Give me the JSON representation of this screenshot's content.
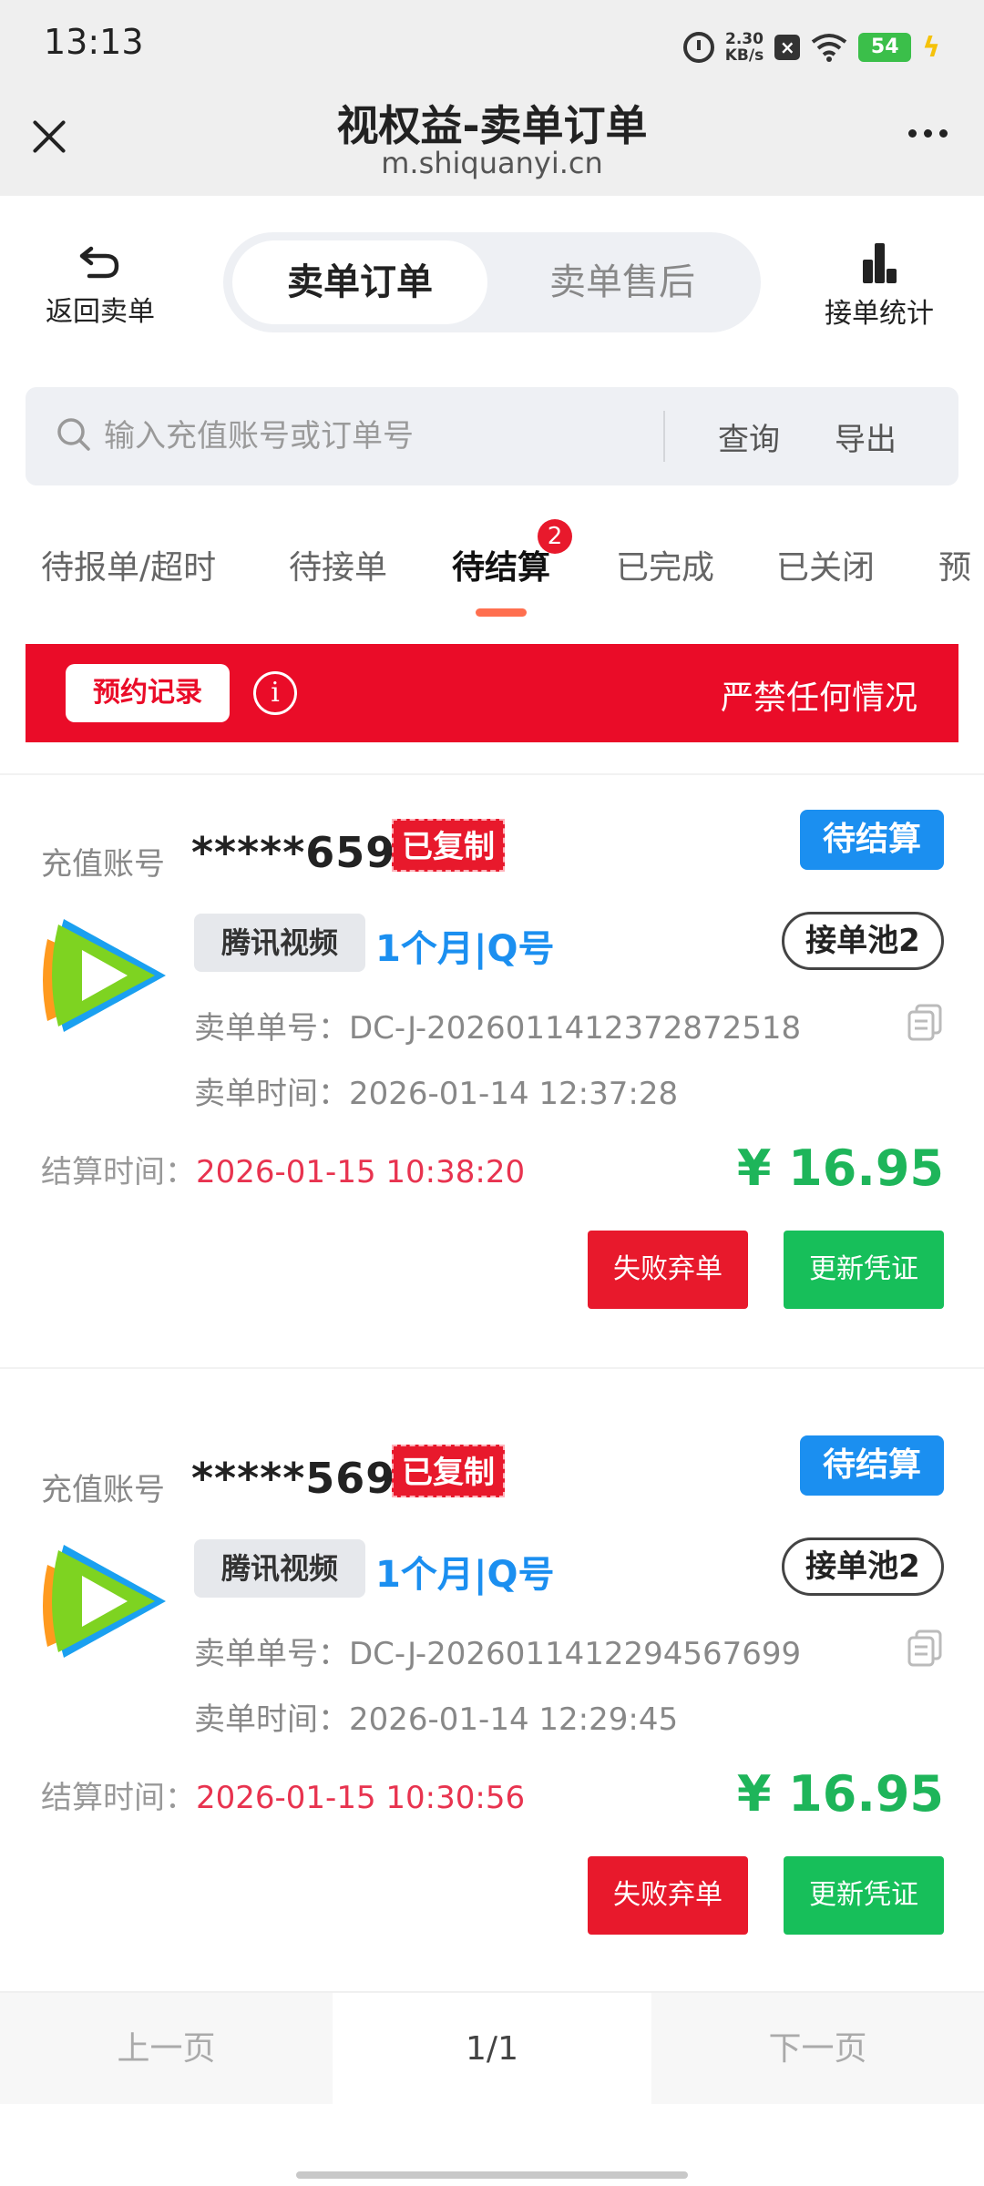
{
  "status_bar": {
    "time": "13:13",
    "net_speed_value": "2.30",
    "net_speed_unit": "KB/s",
    "battery": "54",
    "icons": [
      "alarm-icon",
      "notification-icon",
      "wifi-icon",
      "battery-icon",
      "charging-icon"
    ]
  },
  "title_bar": {
    "title": "视权益-卖单订单",
    "url": "m.shiquanyi.cn"
  },
  "toolbar": {
    "back_label": "返回卖单",
    "segments": [
      "卖单订单",
      "卖单售后"
    ],
    "stats_label": "接单统计"
  },
  "search": {
    "placeholder": "输入充值账号或订单号",
    "query_label": "查询",
    "export_label": "导出"
  },
  "tabs": [
    {
      "label": "待报单/超时"
    },
    {
      "label": "待接单"
    },
    {
      "label": "待结算",
      "badge": "2",
      "active": true
    },
    {
      "label": "已完成"
    },
    {
      "label": "已关闭"
    },
    {
      "label": "预"
    }
  ],
  "notice": {
    "button_label": "预约记录",
    "info_symbol": "i",
    "text": "严禁任何情况"
  },
  "orders": [
    {
      "account_label": "充值账号",
      "account": "*****659",
      "copied_tag": "已复制",
      "status": "待结算",
      "platform": "腾讯视频",
      "product": "1个月|Q号",
      "pool": "接单池2",
      "order_no": "卖单单号：DC-J-2026011412372872518",
      "order_time": "卖单时间：2026-01-14 12:37:28",
      "settle_label": "结算时间：",
      "settle_time": "2026-01-15 10:38:20",
      "price": "¥ 16.95",
      "fail_button": "失败弃单",
      "update_button": "更新凭证"
    },
    {
      "account_label": "充值账号",
      "account": "*****569",
      "copied_tag": "已复制",
      "status": "待结算",
      "platform": "腾讯视频",
      "product": "1个月|Q号",
      "pool": "接单池2",
      "order_no": "卖单单号：DC-J-2026011412294567699",
      "order_time": "卖单时间：2026-01-14 12:29:45",
      "settle_label": "结算时间：",
      "settle_time": "2026-01-15 10:30:56",
      "price": "¥ 16.95",
      "fail_button": "失败弃单",
      "update_button": "更新凭证"
    }
  ],
  "pager": {
    "prev": "上一页",
    "current": "1/1",
    "next": "下一页"
  },
  "colors": {
    "accent_red": "#ea0c28",
    "status_blue": "#1b8ff0",
    "price_green": "#1eb55a",
    "button_green": "#17bf5a",
    "settle_red": "#e8334f",
    "tab_underline": "#ff6f4f"
  }
}
